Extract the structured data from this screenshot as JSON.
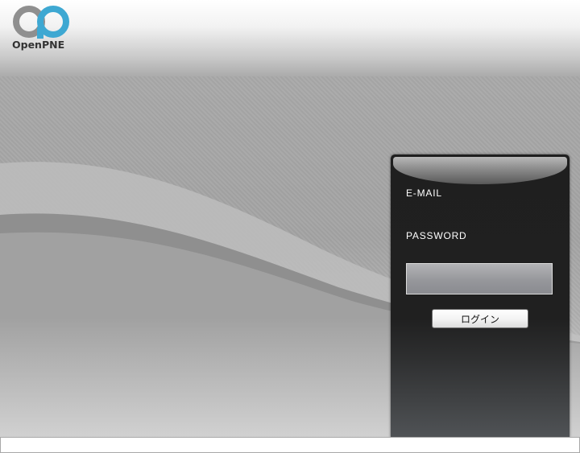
{
  "brand": {
    "logo_text": "OpenPNE",
    "colors": {
      "ring_gray": "#8f8f8f",
      "ring_blue": "#3ea8d2"
    }
  },
  "login": {
    "email_label": "E-MAIL",
    "password_label": "PASSWORD",
    "password_value": "",
    "button_label": "ログイン"
  },
  "status_bar": {
    "text": ""
  }
}
